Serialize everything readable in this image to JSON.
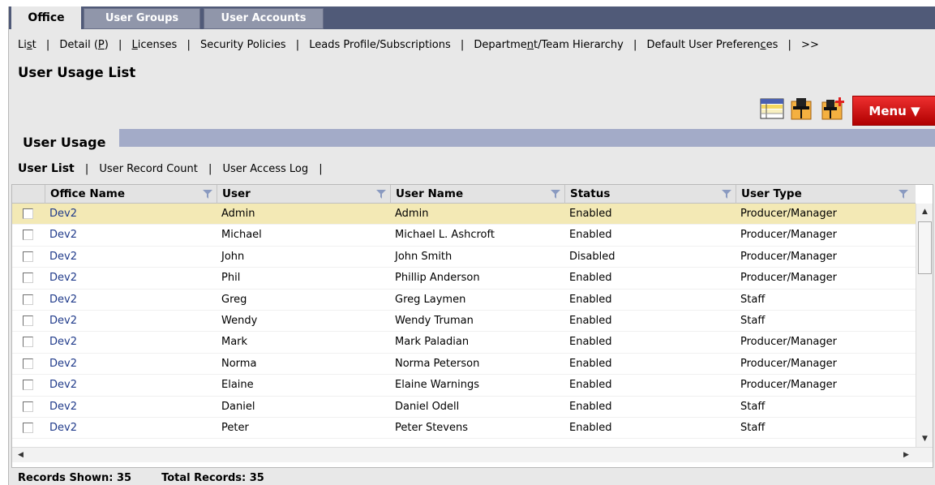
{
  "tabs": [
    {
      "label": "Office",
      "active": true
    },
    {
      "label": "User Groups",
      "active": false
    },
    {
      "label": "User Accounts",
      "active": false
    }
  ],
  "subnav": {
    "list": {
      "pre": "Li",
      "u": "s",
      "post": "t"
    },
    "detail": {
      "pre": "Detail (",
      "u": "P",
      "post": ")"
    },
    "licenses": {
      "pre": "",
      "u": "L",
      "post": "icenses"
    },
    "security": "Security Policies",
    "leads": "Leads Profile/Subscriptions",
    "department": {
      "pre": "Departme",
      "u": "n",
      "post": "t/Team Hierarchy"
    },
    "defaults": {
      "pre": "Default User Preferen",
      "u": "c",
      "post": "es"
    },
    "more": ">>",
    "separator": "|"
  },
  "page_title": "User Usage List",
  "toolbar": {
    "icons": [
      "grid-layout-icon",
      "pin-icon",
      "pin-add-icon"
    ],
    "menu_label": "Menu ▼",
    "menu_color": "#d81818"
  },
  "section": {
    "label": "User Usage"
  },
  "list_nav": {
    "active": "User List",
    "items": [
      "User Record Count",
      "User Access Log"
    ],
    "separator": "|"
  },
  "columns": [
    "Office Name",
    "User",
    "User Name",
    "Status",
    "User Type"
  ],
  "rows": [
    {
      "office": "Dev2",
      "user": "Admin",
      "user_name": "Admin",
      "status": "Enabled",
      "type": "Producer/Manager",
      "selected": true
    },
    {
      "office": "Dev2",
      "user": "Michael",
      "user_name": "Michael L. Ashcroft",
      "status": "Enabled",
      "type": "Producer/Manager"
    },
    {
      "office": "Dev2",
      "user": "John",
      "user_name": "John Smith",
      "status": "Disabled",
      "type": "Producer/Manager"
    },
    {
      "office": "Dev2",
      "user": "Phil",
      "user_name": "Phillip Anderson",
      "status": "Enabled",
      "type": "Producer/Manager"
    },
    {
      "office": "Dev2",
      "user": "Greg",
      "user_name": "Greg Laymen",
      "status": "Enabled",
      "type": "Staff"
    },
    {
      "office": "Dev2",
      "user": "Wendy",
      "user_name": "Wendy Truman",
      "status": "Enabled",
      "type": "Staff"
    },
    {
      "office": "Dev2",
      "user": "Mark",
      "user_name": "Mark Paladian",
      "status": "Enabled",
      "type": "Producer/Manager"
    },
    {
      "office": "Dev2",
      "user": "Norma",
      "user_name": "Norma Peterson",
      "status": "Enabled",
      "type": "Producer/Manager"
    },
    {
      "office": "Dev2",
      "user": "Elaine",
      "user_name": "Elaine Warnings",
      "status": "Enabled",
      "type": "Producer/Manager"
    },
    {
      "office": "Dev2",
      "user": "Daniel",
      "user_name": "Daniel Odell",
      "status": "Enabled",
      "type": "Staff"
    },
    {
      "office": "Dev2",
      "user": "Peter",
      "user_name": "Peter Stevens",
      "status": "Enabled",
      "type": "Staff"
    }
  ],
  "footer": {
    "shown": "Records Shown: 35",
    "total": "Total Records: 35"
  },
  "colors": {
    "topbar": "#505a78",
    "inactive_tab": "#9096aa",
    "section_bar": "#a3abc8",
    "selected_row": "#f3e9b5",
    "link": "#1f3a8a"
  }
}
